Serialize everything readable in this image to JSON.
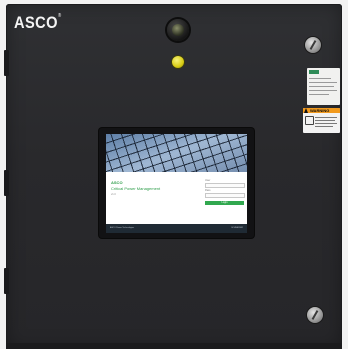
{
  "enclosure": {
    "brand": "ASCO",
    "trademark": "®"
  },
  "hmi": {
    "brand": "ASCO",
    "title": "Critical Power Management",
    "subtitle": "v1.0",
    "username_label": "User",
    "password_label": "Pass",
    "login_label": "Login",
    "footer_left": "ASCO Power Technologies",
    "footer_right": "SCHNEIDER"
  },
  "labels": {
    "warning_text": "WARNING"
  },
  "colors": {
    "cabinet": "#2c2c2f",
    "accent_green": "#31a84f",
    "pilot_lamp": "#e9e23a",
    "warning_orange": "#f29a1d"
  }
}
